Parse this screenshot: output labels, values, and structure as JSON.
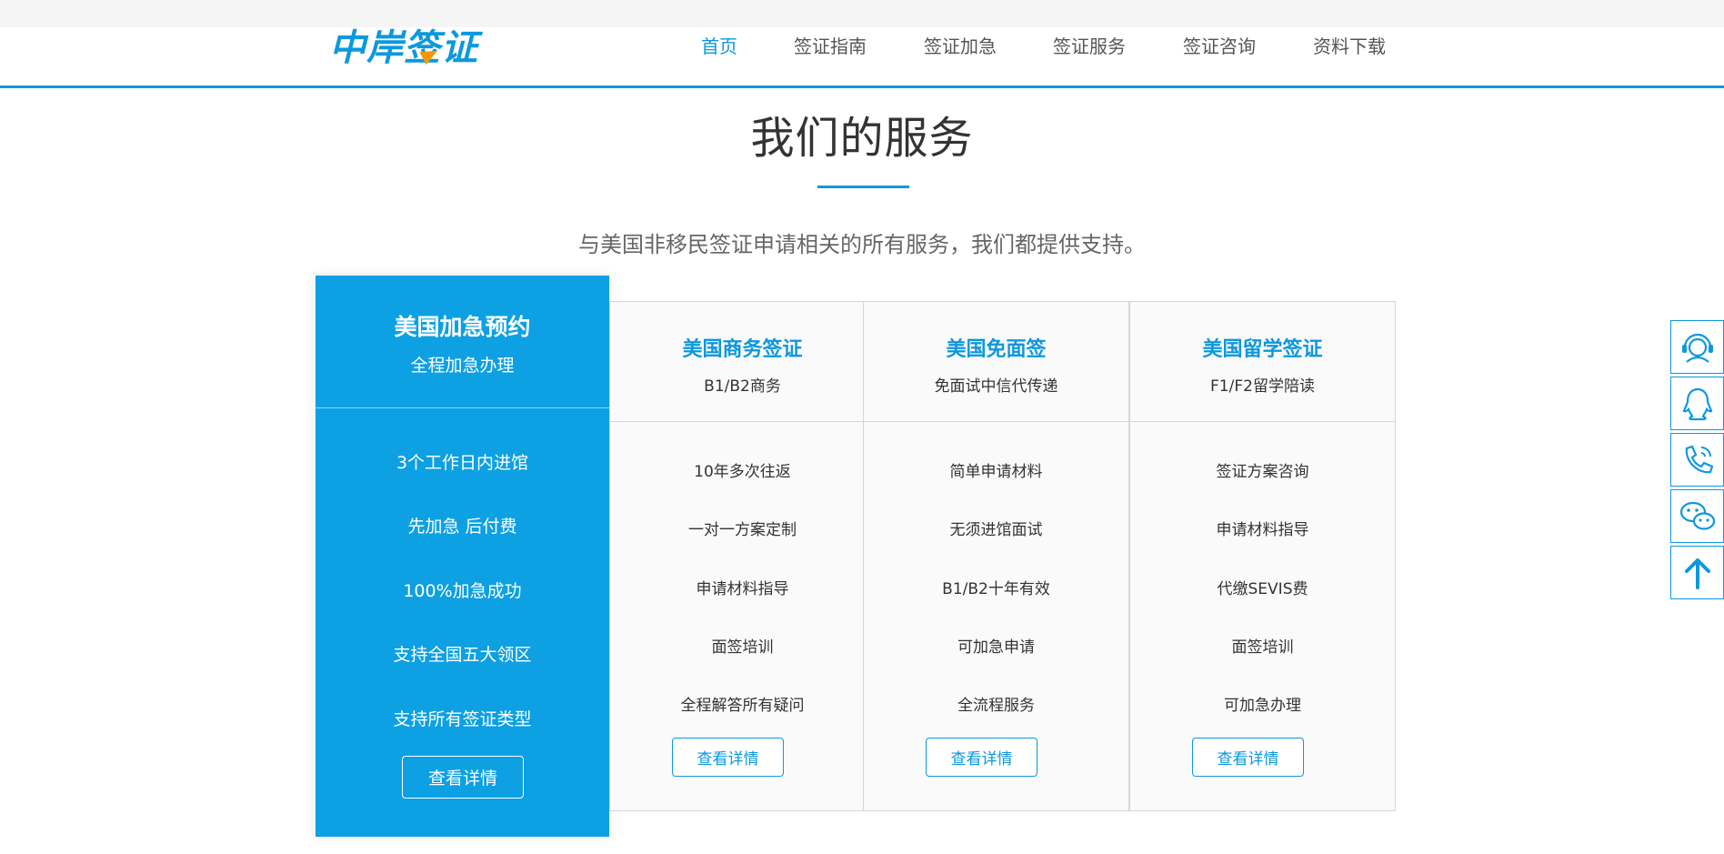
{
  "header": {
    "logo_text": "中岸签证",
    "nav": [
      "首页",
      "签证指南",
      "签证加急",
      "签证服务",
      "签证咨询",
      "资料下载"
    ],
    "active_index": 0
  },
  "section": {
    "title": "我们的服务",
    "subtitle": "与美国非移民签证申请相关的所有服务，我们都提供支持。"
  },
  "featured": {
    "title": "美国加急预约",
    "subtitle": "全程加急办理",
    "items": [
      "3个工作日内进馆",
      "先加急 后付费",
      "100%加急成功",
      "支持全国五大领区",
      "支持所有签证类型"
    ],
    "button": "查看详情"
  },
  "cards": [
    {
      "title": "美国商务签证",
      "subtitle": "B1/B2商务",
      "items": [
        "10年多次往返",
        "一对一方案定制",
        "申请材料指导",
        "面签培训",
        "全程解答所有疑问"
      ],
      "button": "查看详情"
    },
    {
      "title": "美国免面签",
      "subtitle": "免面试中信代传递",
      "items": [
        "简单申请材料",
        "无须进馆面试",
        "B1/B2十年有效",
        "可加急申请",
        "全流程服务"
      ],
      "button": "查看详情"
    },
    {
      "title": "美国留学签证",
      "subtitle": "F1/F2留学陪读",
      "items": [
        "签证方案咨询",
        "申请材料指导",
        "代缴SEVIS费",
        "面签培训",
        "可加急办理"
      ],
      "button": "查看详情"
    }
  ],
  "float_toolbar": {
    "icons": [
      "customer-service-icon",
      "qq-icon",
      "phone-icon",
      "wechat-icon",
      "back-to-top-icon"
    ]
  },
  "colors": {
    "accent": "#0d98dd",
    "feature_bg": "#0da0e3",
    "text": "#333333"
  }
}
